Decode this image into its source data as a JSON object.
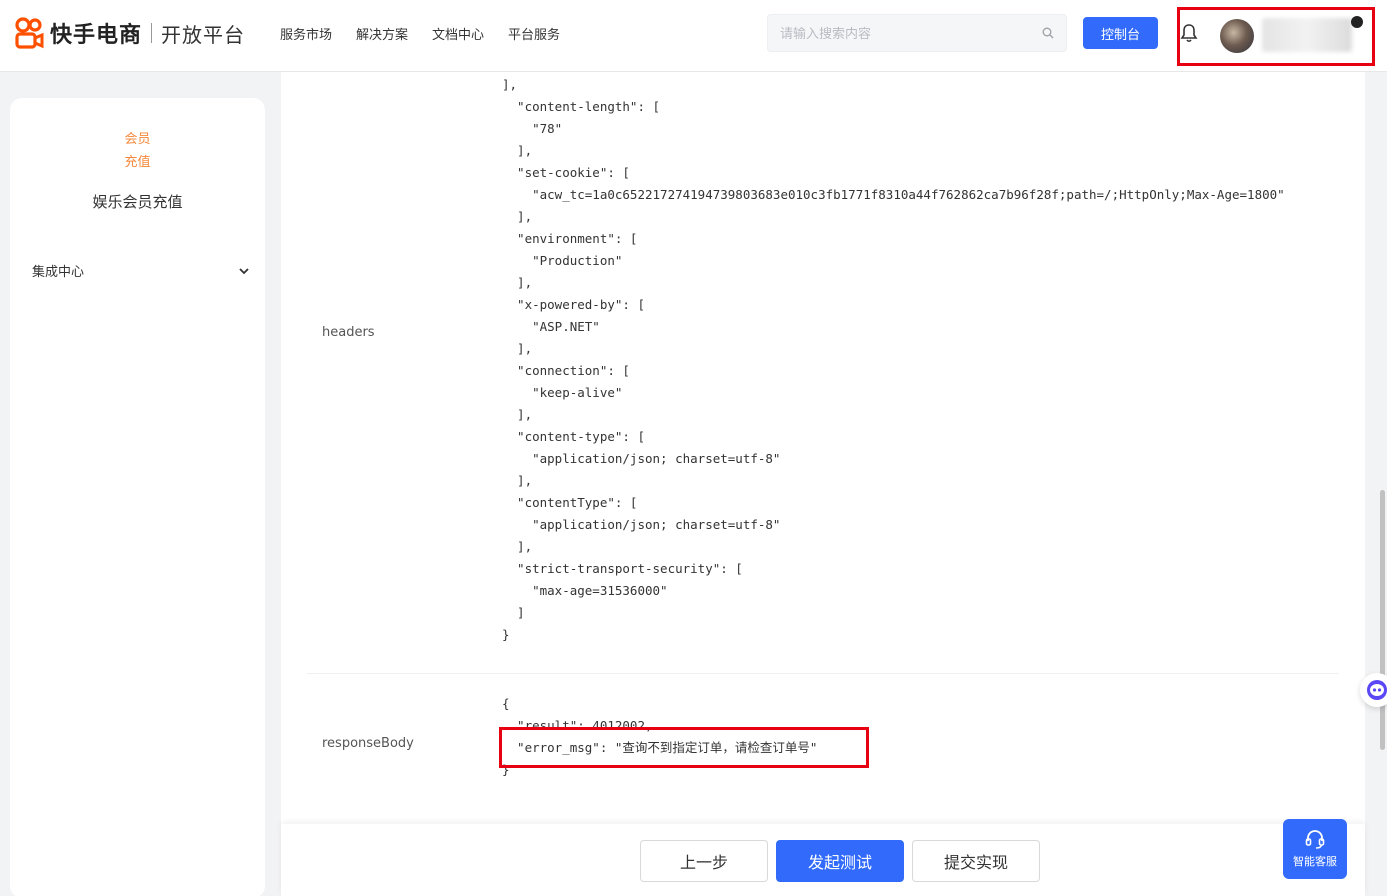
{
  "header": {
    "brand": "快手电商",
    "platform": "开放平台",
    "nav": [
      "服务市场",
      "解决方案",
      "文档中心",
      "平台服务"
    ],
    "search_placeholder": "请输入搜索内容",
    "console_label": "控制台"
  },
  "sidebar": {
    "member_tag_line1": "会员",
    "member_tag_line2": "充值",
    "title": "娱乐会员充值",
    "items": [
      {
        "label": "集成中心"
      }
    ]
  },
  "main": {
    "headers_label": "headers",
    "headers_code": "],\n  \"content-length\": [\n    \"78\"\n  ],\n  \"set-cookie\": [\n    \"acw_tc=1a0c652217274194739803683e010c3fb1771f8310a44f762862ca7b96f28f;path=/;HttpOnly;Max-Age=1800\"\n  ],\n  \"environment\": [\n    \"Production\"\n  ],\n  \"x-powered-by\": [\n    \"ASP.NET\"\n  ],\n  \"connection\": [\n    \"keep-alive\"\n  ],\n  \"content-type\": [\n    \"application/json; charset=utf-8\"\n  ],\n  \"contentType\": [\n    \"application/json; charset=utf-8\"\n  ],\n  \"strict-transport-security\": [\n    \"max-age=31536000\"\n  ]\n}",
    "body_label": "responseBody",
    "body_code": "{\n  \"result\": 4012002,\n  \"error_msg\": \"查询不到指定订单，请检查订单号\"\n}"
  },
  "footer": {
    "prev": "上一步",
    "test": "发起测试",
    "submit": "提交实现"
  },
  "service_label": "智能客服",
  "colors": {
    "primary": "#326bfb",
    "accent": "#f5883b",
    "highlight": "#e60012"
  }
}
